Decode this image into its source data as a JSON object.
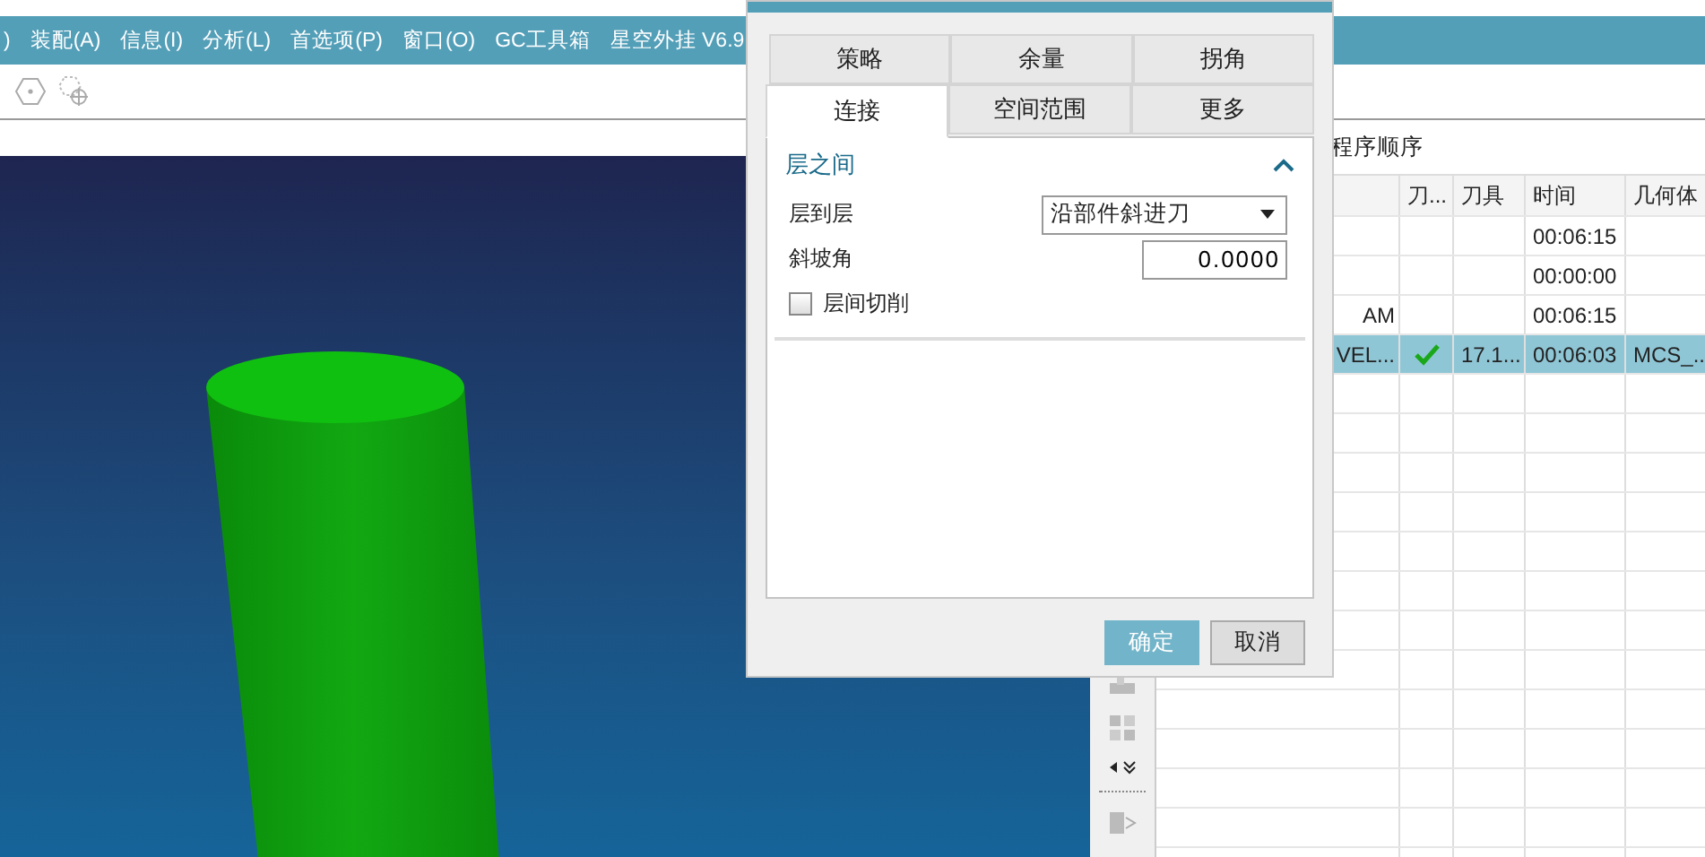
{
  "menu_bar": [
    ")",
    "装配(A)",
    "信息(I)",
    "分析(L)",
    "首选项(P)",
    "窗口(O)",
    "GC工具箱",
    "星空外挂 V6.9"
  ],
  "navigator": {
    "title": "程序顺序",
    "columns": [
      "刀...",
      "刀具",
      "时间",
      "几何体"
    ],
    "rows": [
      {
        "selected": false,
        "time": "00:06:15"
      },
      {
        "selected": false,
        "time": "00:00:00"
      },
      {
        "selected": false,
        "name": "AM",
        "time": "00:06:15"
      },
      {
        "selected": true,
        "name": "VEL...",
        "path_ok": true,
        "tool": "17.1...",
        "time": "00:06:03",
        "geometry": "MCS_..."
      }
    ]
  },
  "dialog": {
    "tab_rows": [
      [
        {
          "label": "策略",
          "selected": false
        },
        {
          "label": "余量",
          "selected": false
        },
        {
          "label": "拐角",
          "selected": false
        }
      ],
      [
        {
          "label": "连接",
          "selected": true
        },
        {
          "label": "空间范围",
          "selected": false
        },
        {
          "label": "更多",
          "selected": false
        }
      ]
    ],
    "section": {
      "title": "层之间",
      "expanded": true
    },
    "fields": [
      {
        "kind": "dropdown",
        "label": "层到层",
        "value": "沿部件斜进刀"
      },
      {
        "kind": "number",
        "label": "斜坡角",
        "value": "0.0000"
      },
      {
        "kind": "checkbox",
        "label": "层间切削",
        "checked": false
      }
    ],
    "buttons": [
      {
        "label": "确定",
        "kind": "primary"
      },
      {
        "label": "取消",
        "kind": "default"
      }
    ]
  }
}
